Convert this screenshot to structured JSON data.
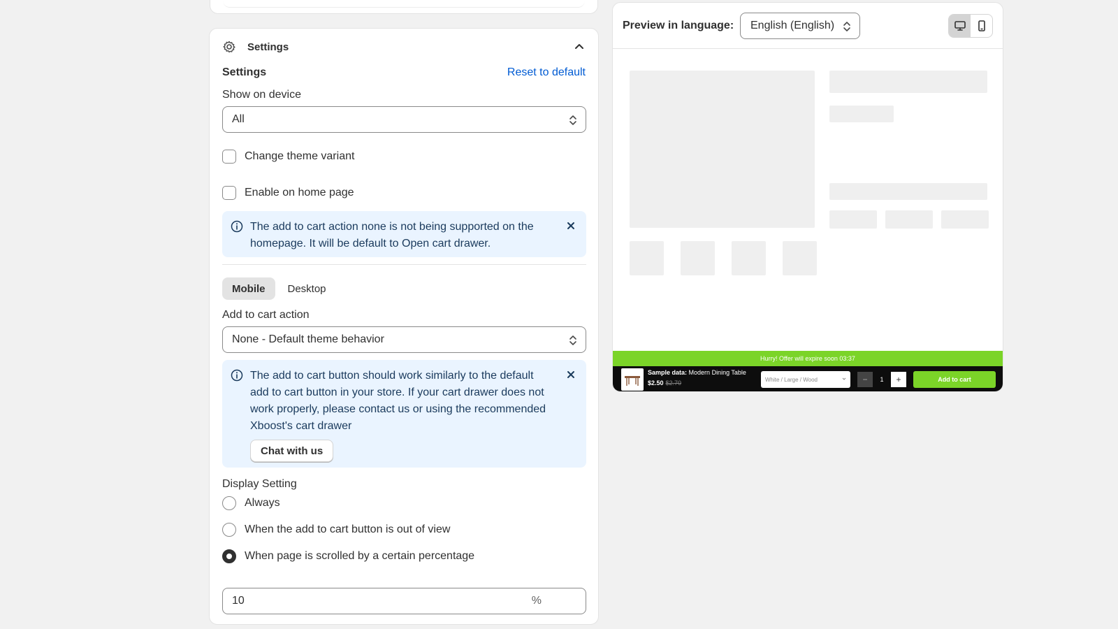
{
  "settings": {
    "header_title": "Settings",
    "section_title": "Settings",
    "reset_link": "Reset to default",
    "show_on_device_label": "Show on device",
    "show_on_device_value": "All",
    "change_theme_variant": "Change theme variant",
    "enable_home_page": "Enable on home page",
    "banner1_text": "The add to cart action none is not being supported on the homepage. It will be default to Open cart drawer.",
    "tabs": [
      "Mobile",
      "Desktop"
    ],
    "active_tab": "Mobile",
    "add_to_cart_label": "Add to cart action",
    "add_to_cart_value": "None - Default theme behavior",
    "banner2_text": "The add to cart button should work similarly to the default add to cart button in your store. If your cart drawer does not work properly, please contact us or using the recommended Xboost's cart drawer",
    "chat_button": "Chat with us",
    "display_setting_label": "Display Setting",
    "display_options": [
      "Always",
      "When the add to cart button is out of view",
      "When page is scrolled by a certain percentage"
    ],
    "selected_display_option": "When page is scrolled by a certain percentage",
    "percentage_value": "10",
    "percentage_suffix": "%"
  },
  "preview": {
    "label": "Preview in language:",
    "language": "English (English)",
    "device_selected": "desktop",
    "offer_text": "Hurry! Offer will expire soon 03:37",
    "product_name_prefix": "Sample data:",
    "product_name": "Modern Dining Table",
    "price": "$2.50",
    "compare_price": "$2.70",
    "variant": "White / Large / Wood",
    "quantity": "1",
    "minus": "−",
    "plus": "+",
    "add_to_cart": "Add to cart"
  },
  "colors": {
    "accent_link": "#005bd3",
    "banner_bg": "#eaf4ff",
    "offer_green": "#7bd428"
  }
}
